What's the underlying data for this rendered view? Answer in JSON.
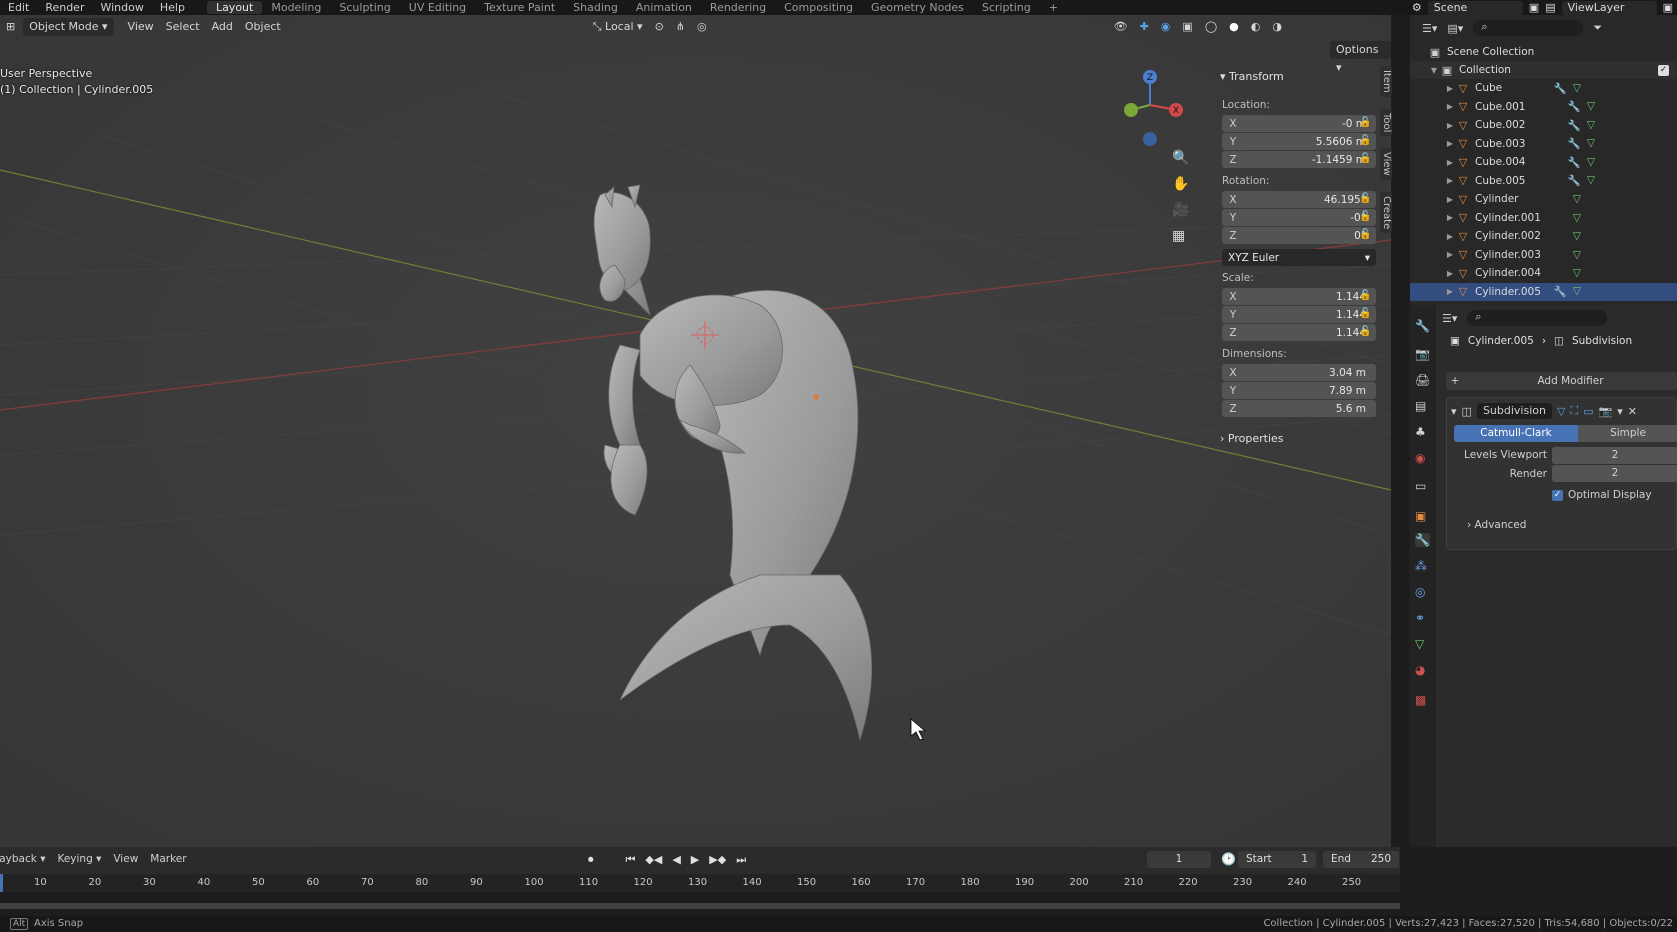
{
  "topbar": {
    "menus": [
      "Edit",
      "Render",
      "Window",
      "Help"
    ],
    "workspaces": [
      "Layout",
      "Modeling",
      "Sculpting",
      "UV Editing",
      "Texture Paint",
      "Shading",
      "Animation",
      "Rendering",
      "Compositing",
      "Geometry Nodes",
      "Scripting"
    ],
    "active_workspace": "Layout",
    "add_tab": "+",
    "scene": "Scene",
    "view_layer": "ViewLayer"
  },
  "viewport": {
    "mode": "Object Mode",
    "menus": [
      "View",
      "Select",
      "Add",
      "Object"
    ],
    "transform_orientation": "Local",
    "options": "Options",
    "perspective": "User Perspective",
    "collection_info": "(1) Collection | Cylinder.005",
    "gizmo": {
      "x": "X",
      "y": "Y",
      "z": "Z"
    },
    "side_tabs": [
      "Item",
      "Tool",
      "View",
      "Create"
    ]
  },
  "npanel": {
    "transform": "Transform",
    "location_label": "Location:",
    "location": [
      {
        "axis": "X",
        "value": "-0 m"
      },
      {
        "axis": "Y",
        "value": "5.5606 m"
      },
      {
        "axis": "Z",
        "value": "-1.1459 m"
      }
    ],
    "rotation_label": "Rotation:",
    "rotation": [
      {
        "axis": "X",
        "value": "46.195°"
      },
      {
        "axis": "Y",
        "value": "-0°"
      },
      {
        "axis": "Z",
        "value": "0°"
      }
    ],
    "rotation_mode": "XYZ Euler",
    "scale_label": "Scale:",
    "scale": [
      {
        "axis": "X",
        "value": "1.144"
      },
      {
        "axis": "Y",
        "value": "1.144"
      },
      {
        "axis": "Z",
        "value": "1.144"
      }
    ],
    "dimensions_label": "Dimensions:",
    "dimensions": [
      {
        "axis": "X",
        "value": "3.04 m"
      },
      {
        "axis": "Y",
        "value": "7.89 m"
      },
      {
        "axis": "Z",
        "value": "5.6 m"
      }
    ],
    "properties": "Properties"
  },
  "outliner": {
    "scene_collection": "Scene Collection",
    "collection": "Collection",
    "items": [
      "Cube",
      "Cube.001",
      "Cube.002",
      "Cube.003",
      "Cube.004",
      "Cube.005",
      "Cylinder",
      "Cylinder.001",
      "Cylinder.002",
      "Cylinder.003",
      "Cylinder.004",
      "Cylinder.005"
    ]
  },
  "properties_panel": {
    "object": "Cylinder.005",
    "modifier_crumb": "Subdivision",
    "add_modifier": "Add Modifier",
    "modifier_name": "Subdivision",
    "method_catmull": "Catmull-Clark",
    "method_simple": "Simple",
    "levels_viewport_label": "Levels Viewport",
    "levels_viewport": "2",
    "render_label": "Render",
    "render": "2",
    "optimal_display": "Optimal Display",
    "advanced": "Advanced"
  },
  "timeline": {
    "menus": [
      "Playback",
      "Keying",
      "View",
      "Marker"
    ],
    "current_frame": "1",
    "start_label": "Start",
    "start": "1",
    "end_label": "End",
    "end": "250",
    "ticks": [
      "10",
      "20",
      "30",
      "40",
      "50",
      "60",
      "70",
      "80",
      "90",
      "100",
      "110",
      "120",
      "130",
      "140",
      "150",
      "160",
      "170",
      "180",
      "190",
      "200",
      "210",
      "220",
      "230",
      "240",
      "250"
    ]
  },
  "statusbar": {
    "alt_key": "Alt",
    "hint": "Axis Snap",
    "stats": "Collection | Cylinder.005 | Verts:27,423 | Faces:27,520 | Tris:54,680 | Objects:0/22"
  },
  "colors": {
    "accent": "#4772b3",
    "mesh_icon": "#e28a3e",
    "viewport_bg": "#3b3b3b"
  }
}
